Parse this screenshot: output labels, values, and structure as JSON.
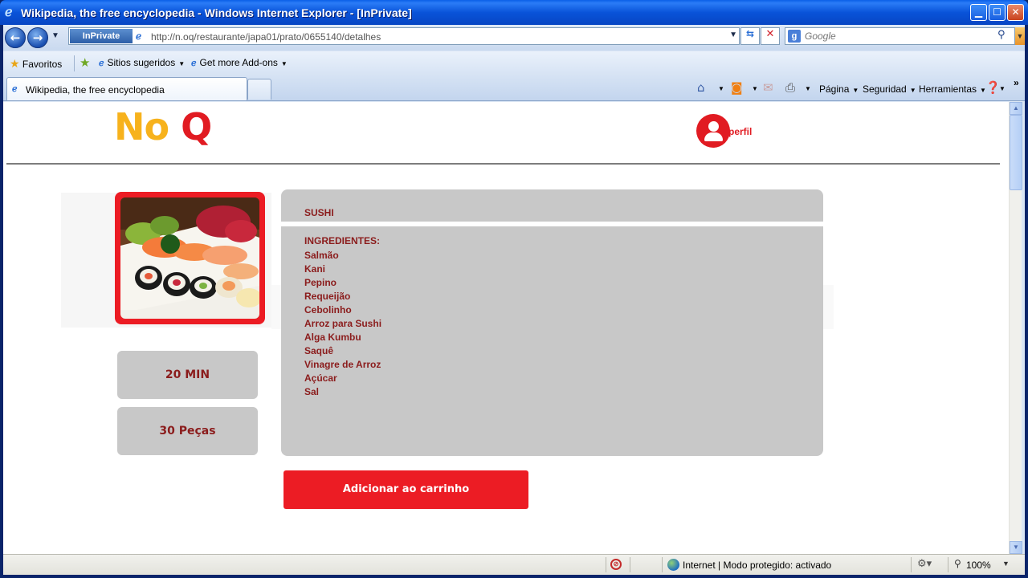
{
  "window": {
    "title": "Wikipedia, the free encyclopedia - Windows Internet Explorer - [InPrivate]",
    "min_glyph": "▁",
    "max_glyph": "☐",
    "close_glyph": "✕"
  },
  "toolbar": {
    "back_glyph": "←",
    "forward_glyph": "→",
    "inprivate_label": "InPrivate",
    "url": "http://n.oq/restaurante/japa01/prato/0655140/detalhes",
    "search_placeholder": "Google",
    "search_logo": "g"
  },
  "favorites_bar": {
    "favorites_label": "Favoritos",
    "suggested_sites_label": "Sitios sugeridos",
    "addons_label": "Get more Add-ons"
  },
  "tabs": [
    {
      "label": "Wikipedia, the free encyclopedia",
      "active": true
    }
  ],
  "command_bar": {
    "page_label": "Página",
    "security_label": "Seguridad",
    "tools_label": "Herramientas"
  },
  "site": {
    "logo_no": "No",
    "logo_q": "Q",
    "profile_label": "perfil"
  },
  "dish": {
    "name": "SUSHI",
    "ingredients_title": "INGREDIENTES:",
    "ingredients": [
      "Salmão",
      "Kani",
      "Pepino",
      "Requeijão",
      "Cebolinho",
      "Arroz para Sushi",
      "Alga Kumbu",
      "Saquê",
      "Vinagre de Arroz",
      "Açúcar",
      "Sal"
    ],
    "prep_time": "20 MIN",
    "pieces": "30 Peças",
    "add_to_cart_label": "Adicionar ao carrinho"
  },
  "status_bar": {
    "zone_text": "Internet | Modo protegido: activado",
    "zoom": "100%"
  },
  "colors": {
    "brand_yellow": "#f7b21c",
    "brand_red": "#e11b22",
    "panel_gray": "#c8c8c8",
    "text_dark_red": "#8b1c1c",
    "ie_titlebar_blue": "#0953d9"
  }
}
